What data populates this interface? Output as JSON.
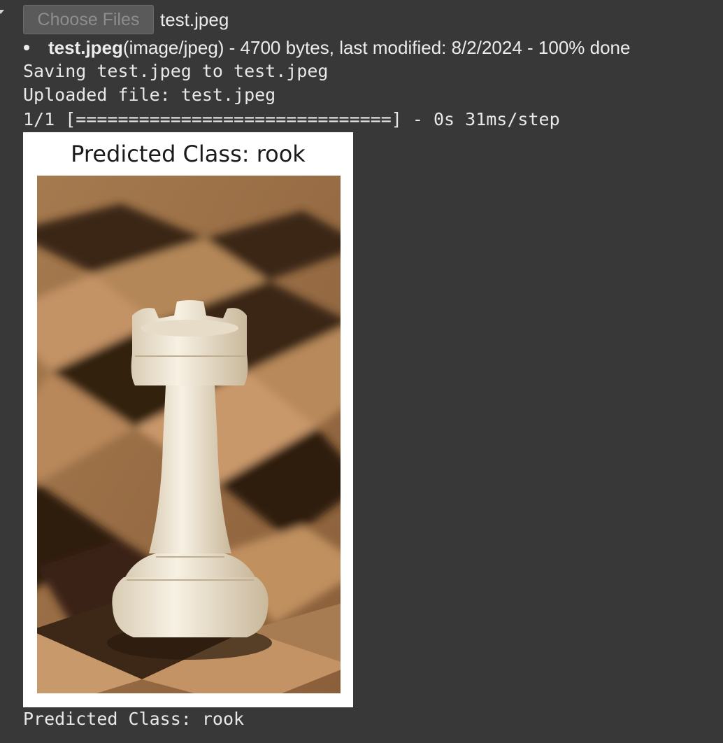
{
  "upload": {
    "button_label": "Choose Files",
    "chosen_file": "test.jpeg"
  },
  "file_list": [
    {
      "name": "test.jpeg",
      "details": "(image/jpeg) - 4700 bytes, last modified: 8/2/2024 - 100% done"
    }
  ],
  "output": {
    "saving_line": "Saving test.jpeg to test.jpeg",
    "uploaded_line": "Uploaded file: test.jpeg",
    "progress_line": "1/1 [==============================] - 0s 31ms/step",
    "result_line": "Predicted Class: rook"
  },
  "figure": {
    "title": "Predicted Class: rook",
    "image_subject": "white-rook-on-chessboard"
  },
  "colors": {
    "background": "#383838",
    "text": "#e8e8e8",
    "button_bg": "#5a5a5a",
    "button_text": "#8d8d8d",
    "figure_bg": "#ffffff"
  }
}
